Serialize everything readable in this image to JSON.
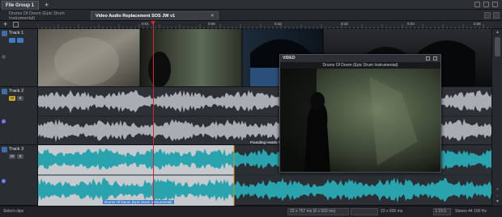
{
  "group_bar": {
    "tab_label": "File Group 1",
    "add_label": "+"
  },
  "file_tabs": [
    {
      "label": "Drums Of Doom (Epic Drum Instrumental)",
      "close": "×"
    },
    {
      "label": "Video Audio Replacement SOS JW v1",
      "close": "×"
    }
  ],
  "ruler": {
    "add_label": "+",
    "labels": [
      "0:01",
      "0:05",
      "0:10",
      "0:15",
      "0:20",
      "0:25",
      "0:30"
    ]
  },
  "tracks": [
    {
      "name": "Track 1"
    },
    {
      "name": "Track 2",
      "m_label": "M",
      "s_label": "S"
    },
    {
      "name": "Track 3",
      "m_label": "M",
      "s_label": "S"
    }
  ],
  "clips": {
    "pounding_label": "Pounding Hearts No Ca",
    "drums_label": "Drums Of Doom (Epic Drum Instrumental)"
  },
  "video_window": {
    "title": "VIDEO",
    "subtitle": "Drums Of Doom (Epic Drum Instrumental)"
  },
  "status_bar": {
    "left_text": "Select clips",
    "sel_size": "23 x 757 ms (6 x 593 ms)",
    "zoom_text": "23 x 935 ms",
    "time_text": "1:19:3",
    "sample_rate": "Stereo 44 100 Hz"
  },
  "colors": {
    "waveform_grey": "#a9adb3",
    "waveform_teal": "#29a3ad",
    "selection": "#c6c9cd",
    "playhead": "#d6252d",
    "accent_blue": "#3d7bc6"
  }
}
